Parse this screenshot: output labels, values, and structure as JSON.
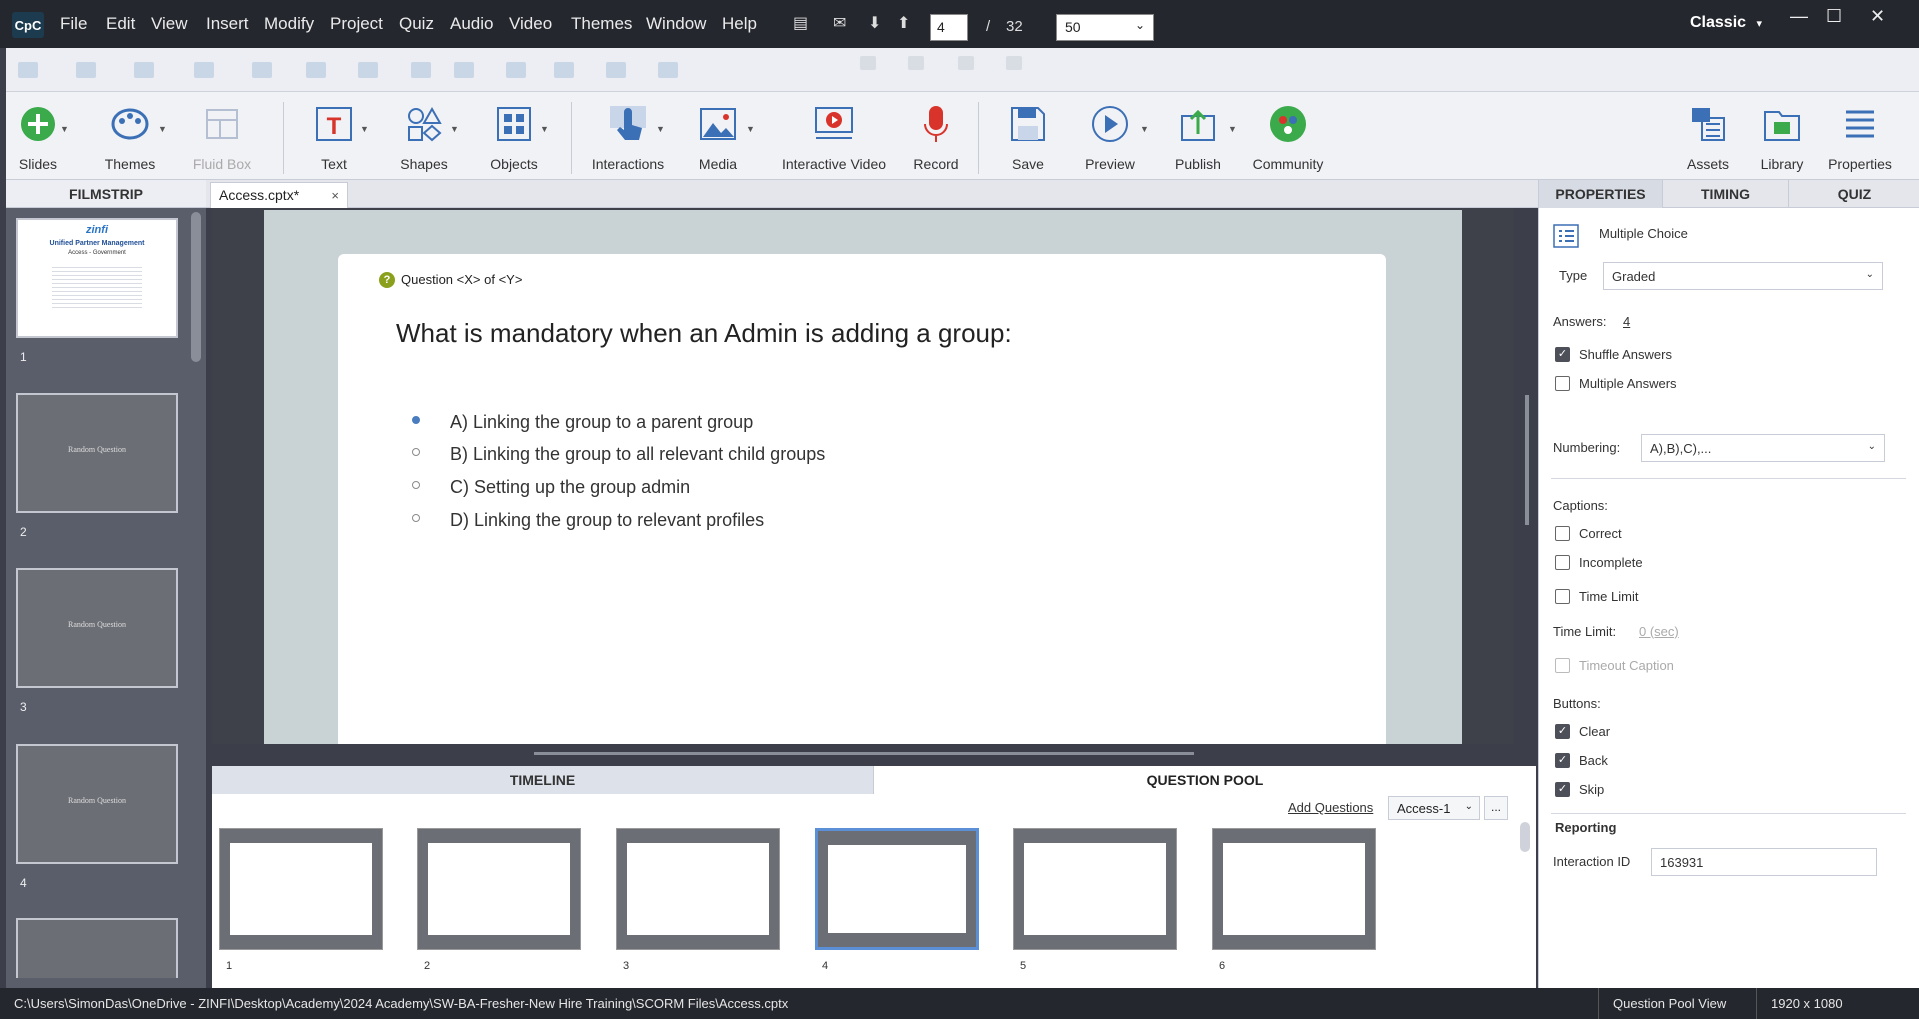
{
  "menubar": {
    "logo": "CpC",
    "items": [
      "File",
      "Edit",
      "View",
      "Insert",
      "Modify",
      "Project",
      "Quiz",
      "Audio",
      "Video",
      "Themes",
      "Window",
      "Help"
    ],
    "page_current": "4",
    "page_separator": "/",
    "page_total": "32",
    "zoom": "50",
    "workspace": "Classic",
    "workspace_chevron": "▾",
    "minimize": "—",
    "maximize": "☐",
    "close": "✕"
  },
  "toolbar": {
    "tools": [
      {
        "label": "Slides",
        "icon": "add-slide-icon"
      },
      {
        "label": "Themes",
        "icon": "palette-icon"
      },
      {
        "label": "Fluid Box",
        "icon": "fluid-box-icon"
      },
      {
        "label": "Text",
        "icon": "text-icon"
      },
      {
        "label": "Shapes",
        "icon": "shapes-icon"
      },
      {
        "label": "Objects",
        "icon": "objects-icon"
      },
      {
        "label": "Interactions",
        "icon": "hand-pointer-icon"
      },
      {
        "label": "Media",
        "icon": "media-image-icon"
      },
      {
        "label": "Interactive Video",
        "icon": "interactive-video-icon"
      },
      {
        "label": "Record",
        "icon": "microphone-icon"
      },
      {
        "label": "Save",
        "icon": "save-icon"
      },
      {
        "label": "Preview",
        "icon": "play-icon"
      },
      {
        "label": "Publish",
        "icon": "publish-icon"
      },
      {
        "label": "Community",
        "icon": "community-icon"
      },
      {
        "label": "Assets",
        "icon": "assets-icon"
      },
      {
        "label": "Library",
        "icon": "library-icon"
      },
      {
        "label": "Properties",
        "icon": "properties-icon"
      }
    ]
  },
  "filmstrip": {
    "title": "FILMSTRIP",
    "slides": [
      {
        "num": "1",
        "title": "Unified Partner Management",
        "subtitle": "Access - Government",
        "brand": "zinfi"
      },
      {
        "num": "2",
        "title": "Random Question"
      },
      {
        "num": "3",
        "title": "Random Question"
      },
      {
        "num": "4",
        "title": "Random Question"
      }
    ]
  },
  "editor": {
    "tab_name": "Access.cptx*",
    "tab_close": "×",
    "question_counter": "Question <X> of <Y>",
    "question_icon": "?",
    "question": "What is mandatory when an Admin is adding a group:",
    "answers": [
      "A) Linking the group to a parent group",
      "B) Linking the group to all relevant child groups",
      "C) Setting up the group admin",
      "D) Linking the group to relevant profiles"
    ],
    "selected_answer": 0
  },
  "bottom_panel": {
    "tab_timeline": "TIMELINE",
    "tab_question_pool": "QUESTION POOL",
    "add_questions": "Add Questions",
    "pool_name": "Access-1",
    "pool_more": "...",
    "thumb_numbers": [
      "1",
      "2",
      "3",
      "4",
      "5",
      "6"
    ],
    "selected_thumb": 4
  },
  "properties": {
    "tab_properties": "PROPERTIES",
    "tab_timing": "TIMING",
    "tab_quiz": "QUIZ",
    "question_type_label": "Multiple Choice",
    "type_label": "Type",
    "type_value": "Graded",
    "answers_label": "Answers:",
    "answers_value": "4",
    "shuffle_answers": "Shuffle Answers",
    "multiple_answers": "Multiple Answers",
    "numbering_label": "Numbering:",
    "numbering_value": "A),B),C),...",
    "captions_label": "Captions:",
    "correct": "Correct",
    "incomplete": "Incomplete",
    "time_limit_cb": "Time Limit",
    "time_limit_label": "Time Limit:",
    "time_limit_value": "0 (sec)",
    "timeout_caption": "Timeout Caption",
    "buttons_label": "Buttons:",
    "clear": "Clear",
    "back": "Back",
    "skip": "Skip",
    "reporting_label": "Reporting",
    "interaction_id_label": "Interaction ID",
    "interaction_id_value": "163931",
    "check": "✓"
  },
  "statusbar": {
    "path": "C:\\Users\\SimonDas\\OneDrive - ZINFI\\Desktop\\Academy\\2024 Academy\\SW-BA-Fresher-New Hire Training\\SCORM Files\\Access.cptx",
    "view": "Question Pool View",
    "resolution": "1920 x 1080"
  },
  "colors": {
    "accent": "#5b8fd6",
    "chrome_dark": "#24272e",
    "question_icon": "#8ba11d"
  }
}
